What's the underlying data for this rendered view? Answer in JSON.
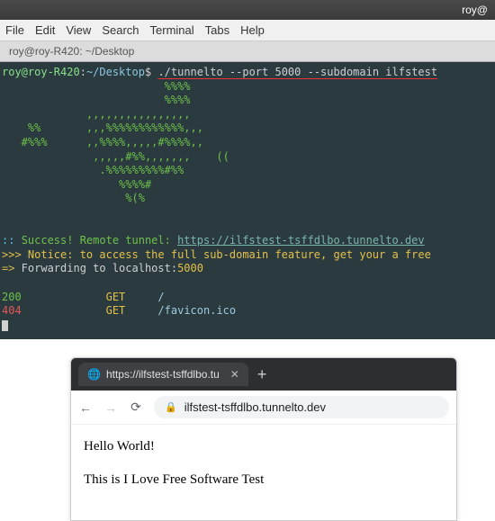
{
  "window": {
    "title_partial": "roy@"
  },
  "menu": {
    "file": "File",
    "edit": "Edit",
    "view": "View",
    "search": "Search",
    "terminal": "Terminal",
    "tabs": "Tabs",
    "help": "Help"
  },
  "tab": {
    "label": "roy@roy-R420: ~/Desktop"
  },
  "terminal": {
    "prompt_userhost": "roy@roy-R420",
    "prompt_sep": ":",
    "prompt_path": "~/Desktop",
    "prompt_dollar": "$",
    "command": "./tunnelto --port 5000 --subdomain ilfstest",
    "ascii": "                         %%%%\n                         %%%%\n             ,,,,,,,,,,,,,,,,\n    %%       ,,,%%%%%%%%%%%%,,,\n   #%%%      ,,%%%%,,,,,#%%%%,,\n              ,,,,,#%%,,,,,,,    ((\n               .%%%%%%%%%#%%\n                  %%%%#\n                   %(%",
    "success_bullet": "::",
    "success_label": "Success! Remote tunnel: ",
    "success_url": "https://ilfstest-tsffdlbo.tunnelto.dev",
    "notice_prefix": ">>> ",
    "notice_text": "Notice: to access the full sub-domain feature, get your a free ",
    "forward_arrow": "=>",
    "forward_text": " Forwarding to localhost:",
    "forward_port": "5000",
    "logs": [
      {
        "status": "200",
        "method": "GET",
        "path": "/"
      },
      {
        "status": "404",
        "method": "GET",
        "path": "/favicon.ico"
      }
    ]
  },
  "browser": {
    "tab_title": "https://ilfstest-tsffdlbo.tu",
    "url": "ilfstest-tsffdlbo.tunnelto.dev",
    "page": {
      "line1": "Hello World!",
      "line2": "This is I Love Free Software Test"
    }
  }
}
